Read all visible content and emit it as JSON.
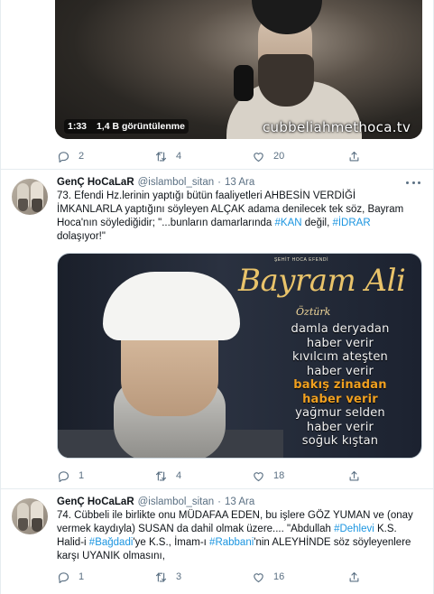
{
  "tweets": [
    {
      "video": {
        "duration": "1:33",
        "views": "1,4 B görüntülenme",
        "watermark": "cubbeliahmethoca.tv"
      },
      "actions": {
        "replies": "2",
        "retweets": "4",
        "likes": "20"
      }
    },
    {
      "author_name": "GenÇ HoCaLaR",
      "handle": "@islambol_sitan",
      "separator": "·",
      "date": "13 Ara",
      "text": {
        "part1": "73. Efendi Hz.lerinin yaptığı bütün faaliyetleri AHBESİN VERDİĞİ İMKANLARLA yaptığını söyleyen ALÇAK adama denilecek tek söz, Bayram Hoca'nın söylediğidir; \"...bunların damarlarında ",
        "tag1": "#KAN",
        "part2": " değil, ",
        "tag2": "#İDRAR",
        "part3": " dolaşıyor!\""
      },
      "poster": {
        "subtitle": "ŞEHİT HOCA EFENDİ",
        "title": "Bayram Ali",
        "title2": "Öztürk",
        "lines": [
          {
            "text": "damla deryadan",
            "highlight": false
          },
          {
            "text": "haber verir",
            "highlight": false
          },
          {
            "text": "kıvılcım ateşten",
            "highlight": false
          },
          {
            "text": "haber verir",
            "highlight": false
          },
          {
            "text": "bakış zinadan",
            "highlight": true
          },
          {
            "text": "haber verir",
            "highlight": true
          },
          {
            "text": "yağmur selden",
            "highlight": false
          },
          {
            "text": "haber verir",
            "highlight": false
          },
          {
            "text": "soğuk kıştan",
            "highlight": false
          }
        ]
      },
      "actions": {
        "replies": "1",
        "retweets": "4",
        "likes": "18"
      }
    },
    {
      "author_name": "GenÇ HoCaLaR",
      "handle": "@islambol_sitan",
      "separator": "·",
      "date": "13 Ara",
      "text": {
        "part1": "74. Cübbeli ile birlikte onu MÜDAFAA EDEN, bu işlere GÖZ YUMAN ve (onay vermek kaydıyla) SUSAN da dahil olmak üzere.... \"Abdullah ",
        "tag1": "#Dehlevi",
        "part2": " K.S. Halid-i ",
        "tag2": "#Bağdadi",
        "part3": "'ye K.S., İmam-ı ",
        "tag3": "#Rabbani",
        "part4": "'nin ALEYHİNDE söz söyleyenlere karşı UYANIK olmasını,"
      },
      "actions": {
        "replies": "1",
        "retweets": "3",
        "likes": "16"
      }
    }
  ]
}
